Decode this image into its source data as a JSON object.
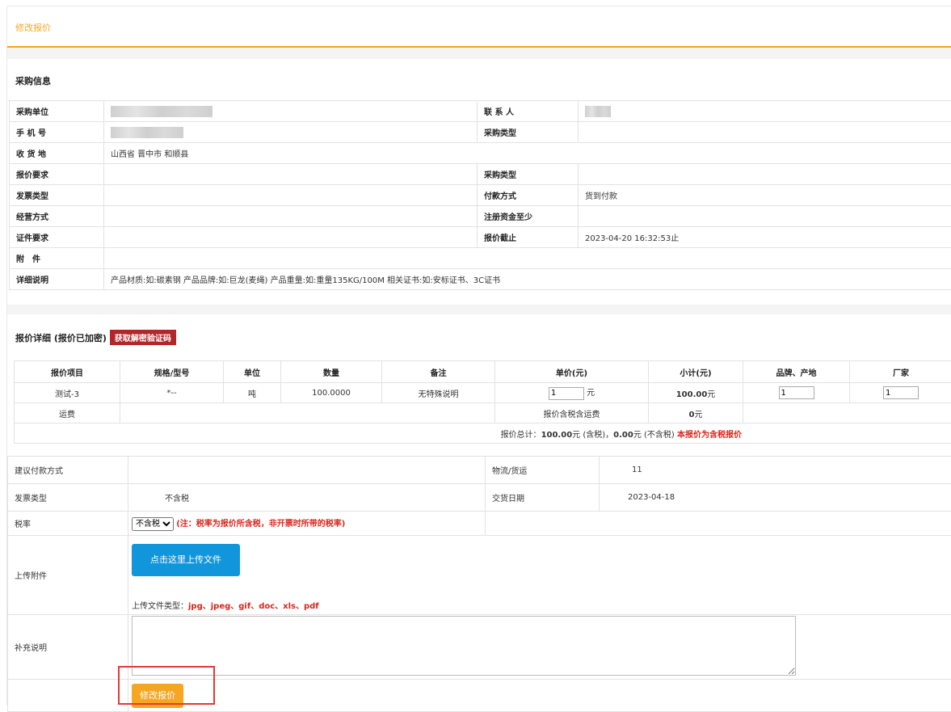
{
  "page": {
    "title": "修改报价"
  },
  "purchase": {
    "section_title": "采购信息",
    "rows": [
      {
        "l1": "采购单位",
        "v1": "",
        "l2": "联 系 人",
        "v2": ""
      },
      {
        "l1": "手 机 号",
        "v1": "",
        "l2": "采购类型",
        "v2": ""
      },
      {
        "l1": "收 货 地",
        "v1": "山西省 晋中市 和顺县"
      },
      {
        "l1": "报价要求",
        "v1": "",
        "l2": "采购类型",
        "v2": ""
      },
      {
        "l1": "发票类型",
        "v1": "",
        "l2": "付款方式",
        "v2": "货到付款"
      },
      {
        "l1": "经营方式",
        "v1": "",
        "l2": "注册资金至少",
        "v2": ""
      },
      {
        "l1": "证件要求",
        "v1": "",
        "l2": "报价截止",
        "v2": "2023-04-20 16:32:53止"
      },
      {
        "l1": "附　件",
        "v1": ""
      },
      {
        "l1": "详细说明",
        "v1": "产品材质:如:碳素钢 产品品牌:如:巨龙(麦绳) 产品重量:如:重量135KG/100M 相关证书:如:安标证书、3C证书"
      }
    ]
  },
  "quote": {
    "section_title": "报价详细 (报价已加密)",
    "decrypt_button": "获取解密验证码",
    "headers": [
      "报价项目",
      "规格/型号",
      "单位",
      "数量",
      "备注",
      "单价(元)",
      "小计(元)",
      "品牌、产地",
      "厂家"
    ],
    "item": {
      "name": "测试-3",
      "spec": "*--",
      "unit": "吨",
      "qty": "100.0000",
      "note": "无特殊说明",
      "price": "1",
      "price_unit": "元",
      "subtotal": "100.00",
      "subtotal_unit": "元",
      "brand": "1",
      "maker": "1"
    },
    "freight": {
      "label": "运费",
      "note": "报价含税含运费",
      "value": "0",
      "unit": "元"
    },
    "total": {
      "prefix": "报价总计：",
      "tax_amount": "100.00",
      "tax_text": "元 (含税)，",
      "notax_amount": "0.00",
      "notax_text": "元 (不含税)",
      "note": "本报价为含税报价"
    }
  },
  "extra": {
    "payment_label": "建议付款方式",
    "logistics_label": "物流/货运",
    "logistics_value": "11",
    "invoice_label": "发票类型",
    "invoice_value": "不含税",
    "delivery_label": "交货日期",
    "delivery_value": "2023-04-18",
    "tax_label": "税率",
    "tax_selected": "不含税",
    "tax_note": "(注：税率为报价所含税，非开票时所带的税率)",
    "upload_label": "上传附件",
    "upload_button": "点击这里上传文件",
    "filetype_prefix": "上传文件类型：",
    "filetypes": "jpg、jpeg、gif、doc、xls、pdf",
    "remark_label": "补充说明",
    "submit_button": "修改报价"
  },
  "colors": {
    "accent": "#f5a623",
    "blue": "#1296db",
    "red": "#d9261c",
    "badge": "#b3262a"
  }
}
